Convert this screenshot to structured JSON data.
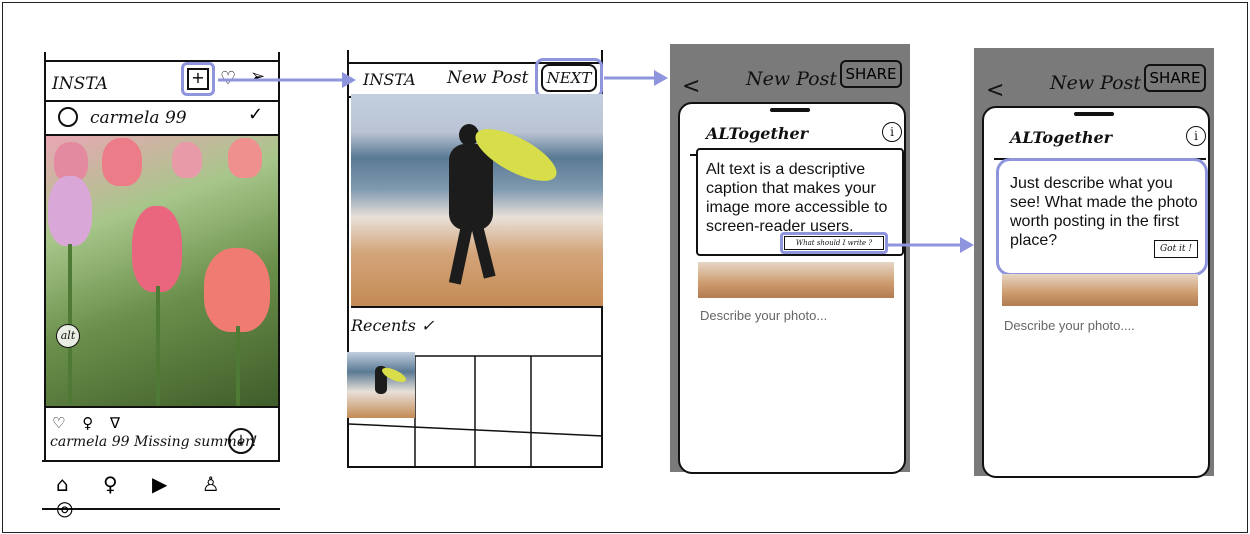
{
  "screen1": {
    "app_title": "INSTA",
    "plus_icon": "+",
    "heart_icon": "♡",
    "send_icon": "➢",
    "username": "carmela 99",
    "check_icon": "✓",
    "alt_badge": "alt",
    "action_icons": "♡ ♀ ∇",
    "caption_user": "carmela 99",
    "caption_text": "Missing summer!",
    "download_icon": "↓",
    "nav_icons": "⌂ ♀ ▶ ♙ ◎"
  },
  "screen2": {
    "app_title": "INSTA",
    "title": "New Post",
    "next_label": "NEXT",
    "recents_label": "Recents",
    "recents_check": "✓"
  },
  "screen3": {
    "back_icon": "<",
    "title": "New Post",
    "share_label": "SHARE",
    "app_name": "ALTogether",
    "info_icon": "i",
    "card_text": "Alt text is a descriptive caption that makes your image more accessible to screen-reader users.",
    "tip_label": "What should I write ?",
    "description_placeholder": "Describe your photo..."
  },
  "screen4": {
    "back_icon": "<",
    "title": "New Post",
    "share_label": "SHARE",
    "app_name": "ALTogether",
    "info_icon": "i",
    "card_text": "Just describe what you see! What made the photo worth posting in the first place?",
    "got_it_label": "Got it !",
    "description_placeholder": "Describe your photo...."
  },
  "colors": {
    "highlight": "#8e95dd",
    "phone_frame": "#7a7a7a"
  }
}
